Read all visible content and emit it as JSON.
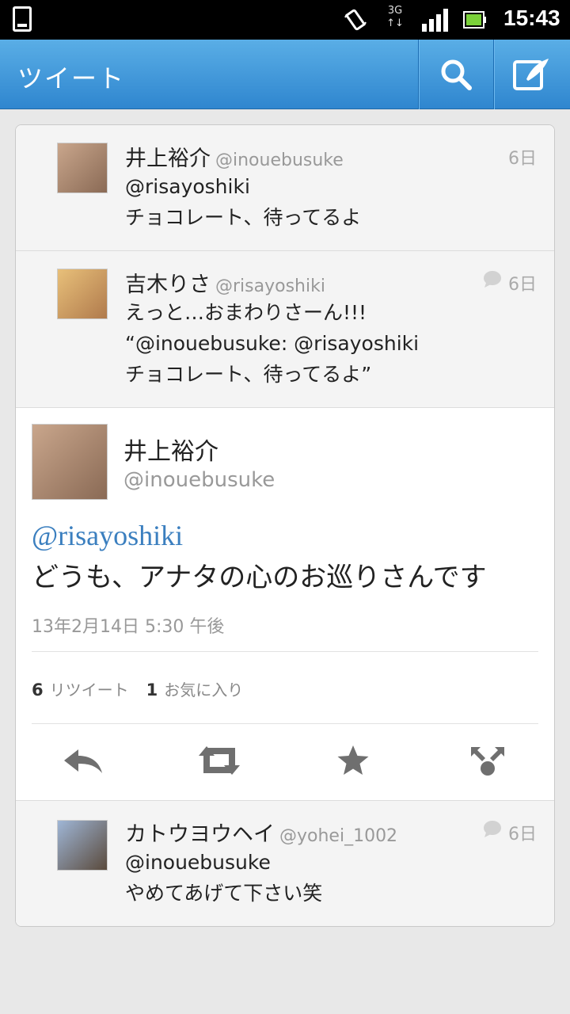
{
  "status_bar": {
    "time": "15:43",
    "network": "3G"
  },
  "action_bar": {
    "title": "ツイート",
    "search_icon": "search-icon",
    "compose_icon": "compose-icon"
  },
  "conversation": [
    {
      "name": "井上裕介",
      "handle": "@inouebusuke",
      "time": "6日",
      "lines": [
        "@risayoshiki",
        "チョコレート、待ってるよ"
      ],
      "has_reply_icon": false
    },
    {
      "name": "吉木りさ",
      "handle": "@risayoshiki",
      "time": "6日",
      "lines": [
        "えっと…おまわりさーん!!!",
        "“@inouebusuke: @risayoshiki",
        "チョコレート、待ってるよ”"
      ],
      "has_reply_icon": true
    }
  ],
  "main_tweet": {
    "name": "井上裕介",
    "handle": "@inouebusuke",
    "mention": "@risayoshiki",
    "text": "どうも、アナタの心のお巡りさんです",
    "date": "13年2月14日 5:30 午後",
    "retweet_count": "6",
    "retweet_label": "リツイート",
    "favorite_count": "1",
    "favorite_label": "お気に入り",
    "actions": [
      "reply-icon",
      "retweet-icon",
      "favorite-icon",
      "share-icon"
    ]
  },
  "replies": [
    {
      "name": "カトウヨウヘイ",
      "handle": "@yohei_1002",
      "time": "6日",
      "lines": [
        "@inouebusuke",
        "やめてあげて下さい笑"
      ],
      "has_reply_icon": true
    }
  ],
  "colors": {
    "action_bar": "#3a90d8",
    "mention": "#3b7fbf"
  }
}
